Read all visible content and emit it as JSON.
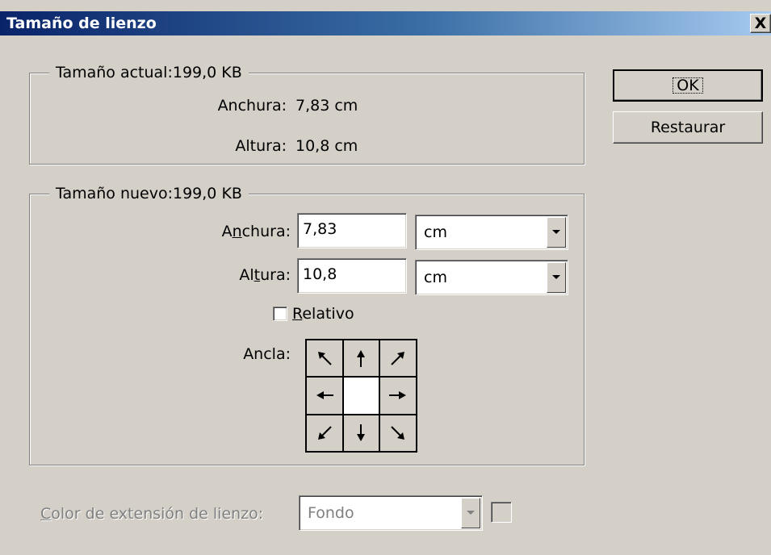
{
  "window": {
    "title": "Tamaño de lienzo",
    "close_glyph": "X"
  },
  "current_size": {
    "legend": "Tamaño actual:199,0 KB",
    "width_label": "Anchura:",
    "width_value": "7,83 cm",
    "height_label": "Altura:",
    "height_value": "10,8 cm"
  },
  "new_size": {
    "legend": "Tamaño nuevo:199,0 KB",
    "width_label_pre": "A",
    "width_label_mnemonic": "n",
    "width_label_post": "chura:",
    "width_value": "7,83",
    "width_unit": "cm",
    "height_label_pre": "Al",
    "height_label_mnemonic": "t",
    "height_label_post": "ura:",
    "height_value": "10,8",
    "height_unit": "cm",
    "relative_mnemonic": "R",
    "relative_post": "elativo",
    "relative_checked": false,
    "anchor_label": "Ancla:",
    "anchor_cells": [
      "arrow-nw-icon",
      "arrow-n-icon",
      "arrow-ne-icon",
      "arrow-w-icon",
      "anchor-center",
      "arrow-e-icon",
      "arrow-sw-icon",
      "arrow-s-icon",
      "arrow-se-icon"
    ]
  },
  "buttons": {
    "ok": "OK",
    "reset": "Restaurar"
  },
  "extension_color": {
    "label_mnemonic": "C",
    "label_post": "olor de extensión de lienzo:",
    "value": "Fondo",
    "enabled": false
  }
}
